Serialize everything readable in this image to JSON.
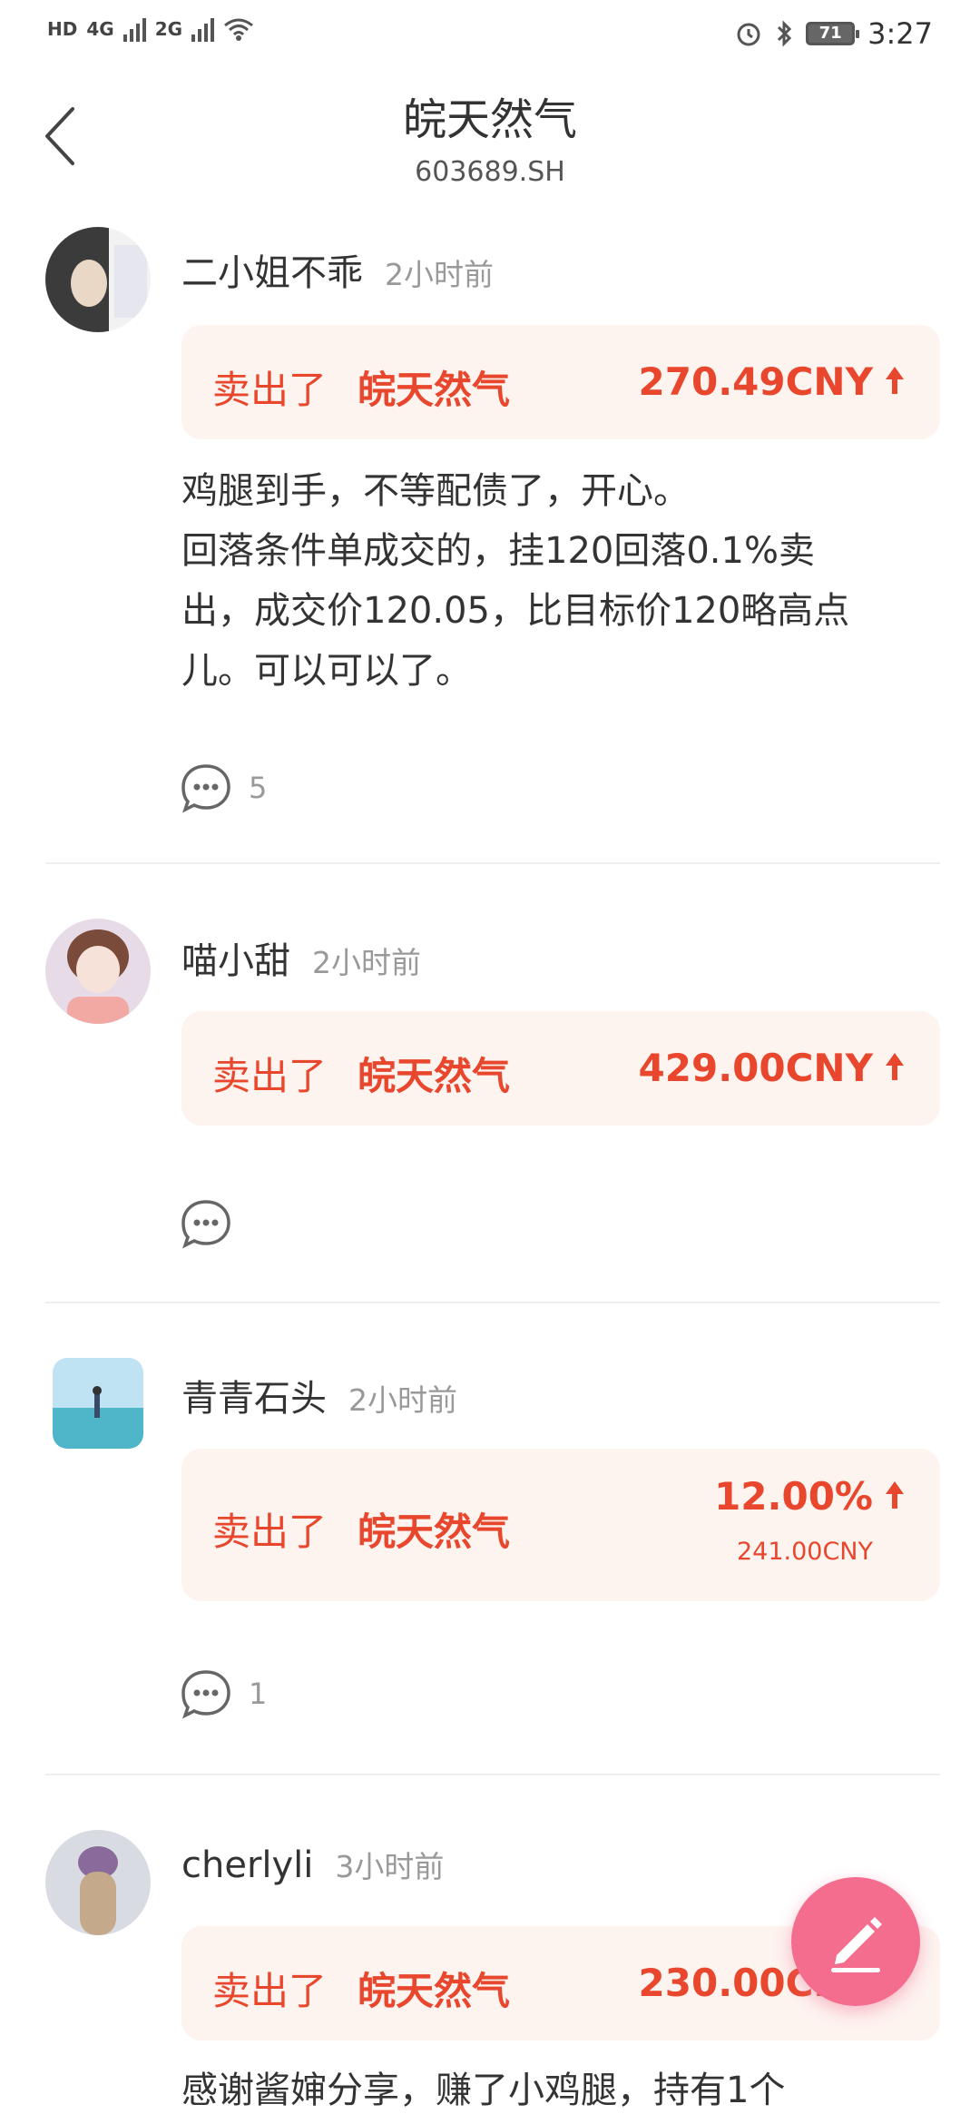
{
  "status_bar": {
    "left_labels": [
      "HD",
      "4G",
      "2G"
    ],
    "battery": "71",
    "time": "3:27"
  },
  "header": {
    "title": "皖天然气",
    "code": "603689.SH"
  },
  "posts": [
    {
      "user": "二小姐不乖",
      "time": "2小时前",
      "trade": {
        "action": "卖出了",
        "stock": "皖天然气",
        "price": "270.49CNY",
        "sub": ""
      },
      "content": [
        "鸡腿到手，不等配债了，开心。",
        "回落条件单成交的，挂120回落0.1%卖",
        "出，成交价120.05，比目标价120略高点",
        "儿。可以可以了。"
      ],
      "comments": "5"
    },
    {
      "user": "喵小甜",
      "time": "2小时前",
      "trade": {
        "action": "卖出了",
        "stock": "皖天然气",
        "price": "429.00CNY",
        "sub": ""
      },
      "content": [],
      "comments": ""
    },
    {
      "user": "青青石头",
      "time": "2小时前",
      "trade": {
        "action": "卖出了",
        "stock": "皖天然气",
        "price": "12.00%",
        "sub": "241.00CNY"
      },
      "content": [],
      "comments": "1"
    },
    {
      "user": "cherlyli",
      "time": "3小时前",
      "trade": {
        "action": "卖出了",
        "stock": "皖天然气",
        "price": "230.00CNY",
        "sub": ""
      },
      "content": [
        "感谢酱婶分享，赚了小鸡腿，持有1个"
      ],
      "comments": ""
    }
  ],
  "icons": {
    "back": "chevron-left-icon",
    "comment": "comment-bubble-icon",
    "up_arrow": "arrow-up-icon",
    "compose": "pencil-icon"
  },
  "colors": {
    "accent": "#e8472e",
    "card_bg": "#fdf3ef",
    "fab": "#f46c8e"
  }
}
